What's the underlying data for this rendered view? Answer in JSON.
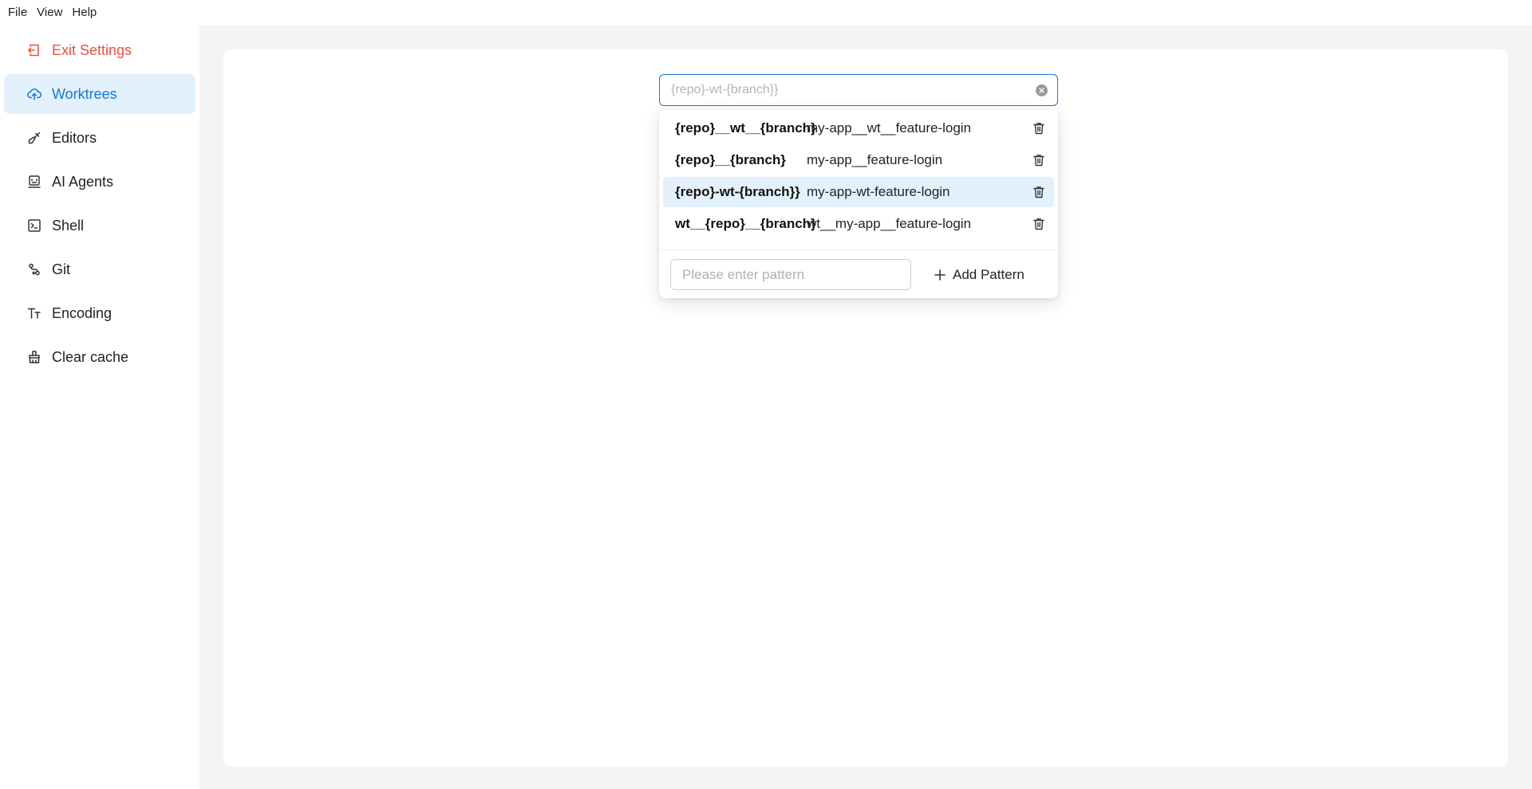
{
  "menubar": {
    "items": [
      "File",
      "View",
      "Help"
    ]
  },
  "sidebar": {
    "exit_label": "Exit Settings",
    "items": [
      {
        "label": "Worktrees",
        "icon": "cloud-upload-icon"
      },
      {
        "label": "Editors",
        "icon": "brush-icon"
      },
      {
        "label": "AI Agents",
        "icon": "robot-icon"
      },
      {
        "label": "Shell",
        "icon": "terminal-icon"
      },
      {
        "label": "Git",
        "icon": "git-branch-icon"
      },
      {
        "label": "Encoding",
        "icon": "text-size-icon"
      },
      {
        "label": "Clear cache",
        "icon": "broom-icon"
      }
    ],
    "active": "Worktrees"
  },
  "pattern_select": {
    "placeholder": "{repo}-wt-{branch}}",
    "options": [
      {
        "pattern": "{repo}__wt__{branch}",
        "example": "my-app__wt__feature-login"
      },
      {
        "pattern": "{repo}__{branch}",
        "example": "my-app__feature-login"
      },
      {
        "pattern": "{repo}-wt-{branch}}",
        "example": "my-app-wt-feature-login"
      },
      {
        "pattern": "wt__{repo}__{branch}",
        "example": "wt__my-app__feature-login"
      }
    ],
    "selected_index": 2,
    "new_pattern_placeholder": "Please enter pattern",
    "add_label": "Add Pattern"
  },
  "colors": {
    "accent": "#1677d9",
    "active_bg": "#e3f1fc",
    "exit": "#e8513f",
    "content_bg": "#f4f4f4"
  }
}
